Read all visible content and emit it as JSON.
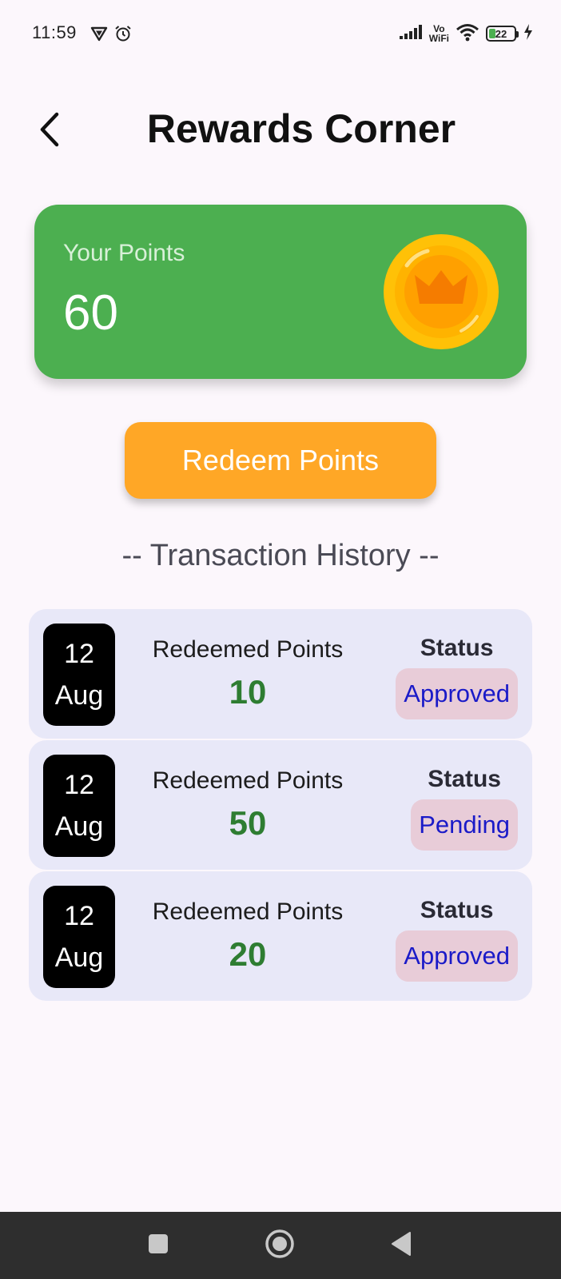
{
  "status_bar": {
    "time": "11:59",
    "network_label_top": "Vo",
    "network_label_bottom": "WiFi",
    "battery_level": "22",
    "icons": [
      "vpn-icon",
      "alarm-icon",
      "signal-icon",
      "wifi-icon",
      "battery-icon",
      "charging-icon"
    ]
  },
  "header": {
    "title": "Rewards Corner",
    "back_icon": "chevron-left-icon"
  },
  "points_card": {
    "label": "Your Points",
    "value": "60",
    "icon": "crown-coin-icon",
    "color": "#4CAF50"
  },
  "redeem_button": {
    "label": "Redeem Points",
    "color": "#FFA726"
  },
  "history": {
    "title": "-- Transaction History --",
    "items": [
      {
        "day": "12",
        "month": "Aug",
        "label": "Redeemed Points",
        "points": "10",
        "status_label": "Status",
        "status": "Approved"
      },
      {
        "day": "12",
        "month": "Aug",
        "label": "Redeemed Points",
        "points": "50",
        "status_label": "Status",
        "status": "Pending"
      },
      {
        "day": "12",
        "month": "Aug",
        "label": "Redeemed Points",
        "points": "20",
        "status_label": "Status",
        "status": "Approved"
      }
    ]
  },
  "nav_bar": {
    "icons": [
      "recents-square-icon",
      "home-circle-icon",
      "back-triangle-icon"
    ]
  }
}
